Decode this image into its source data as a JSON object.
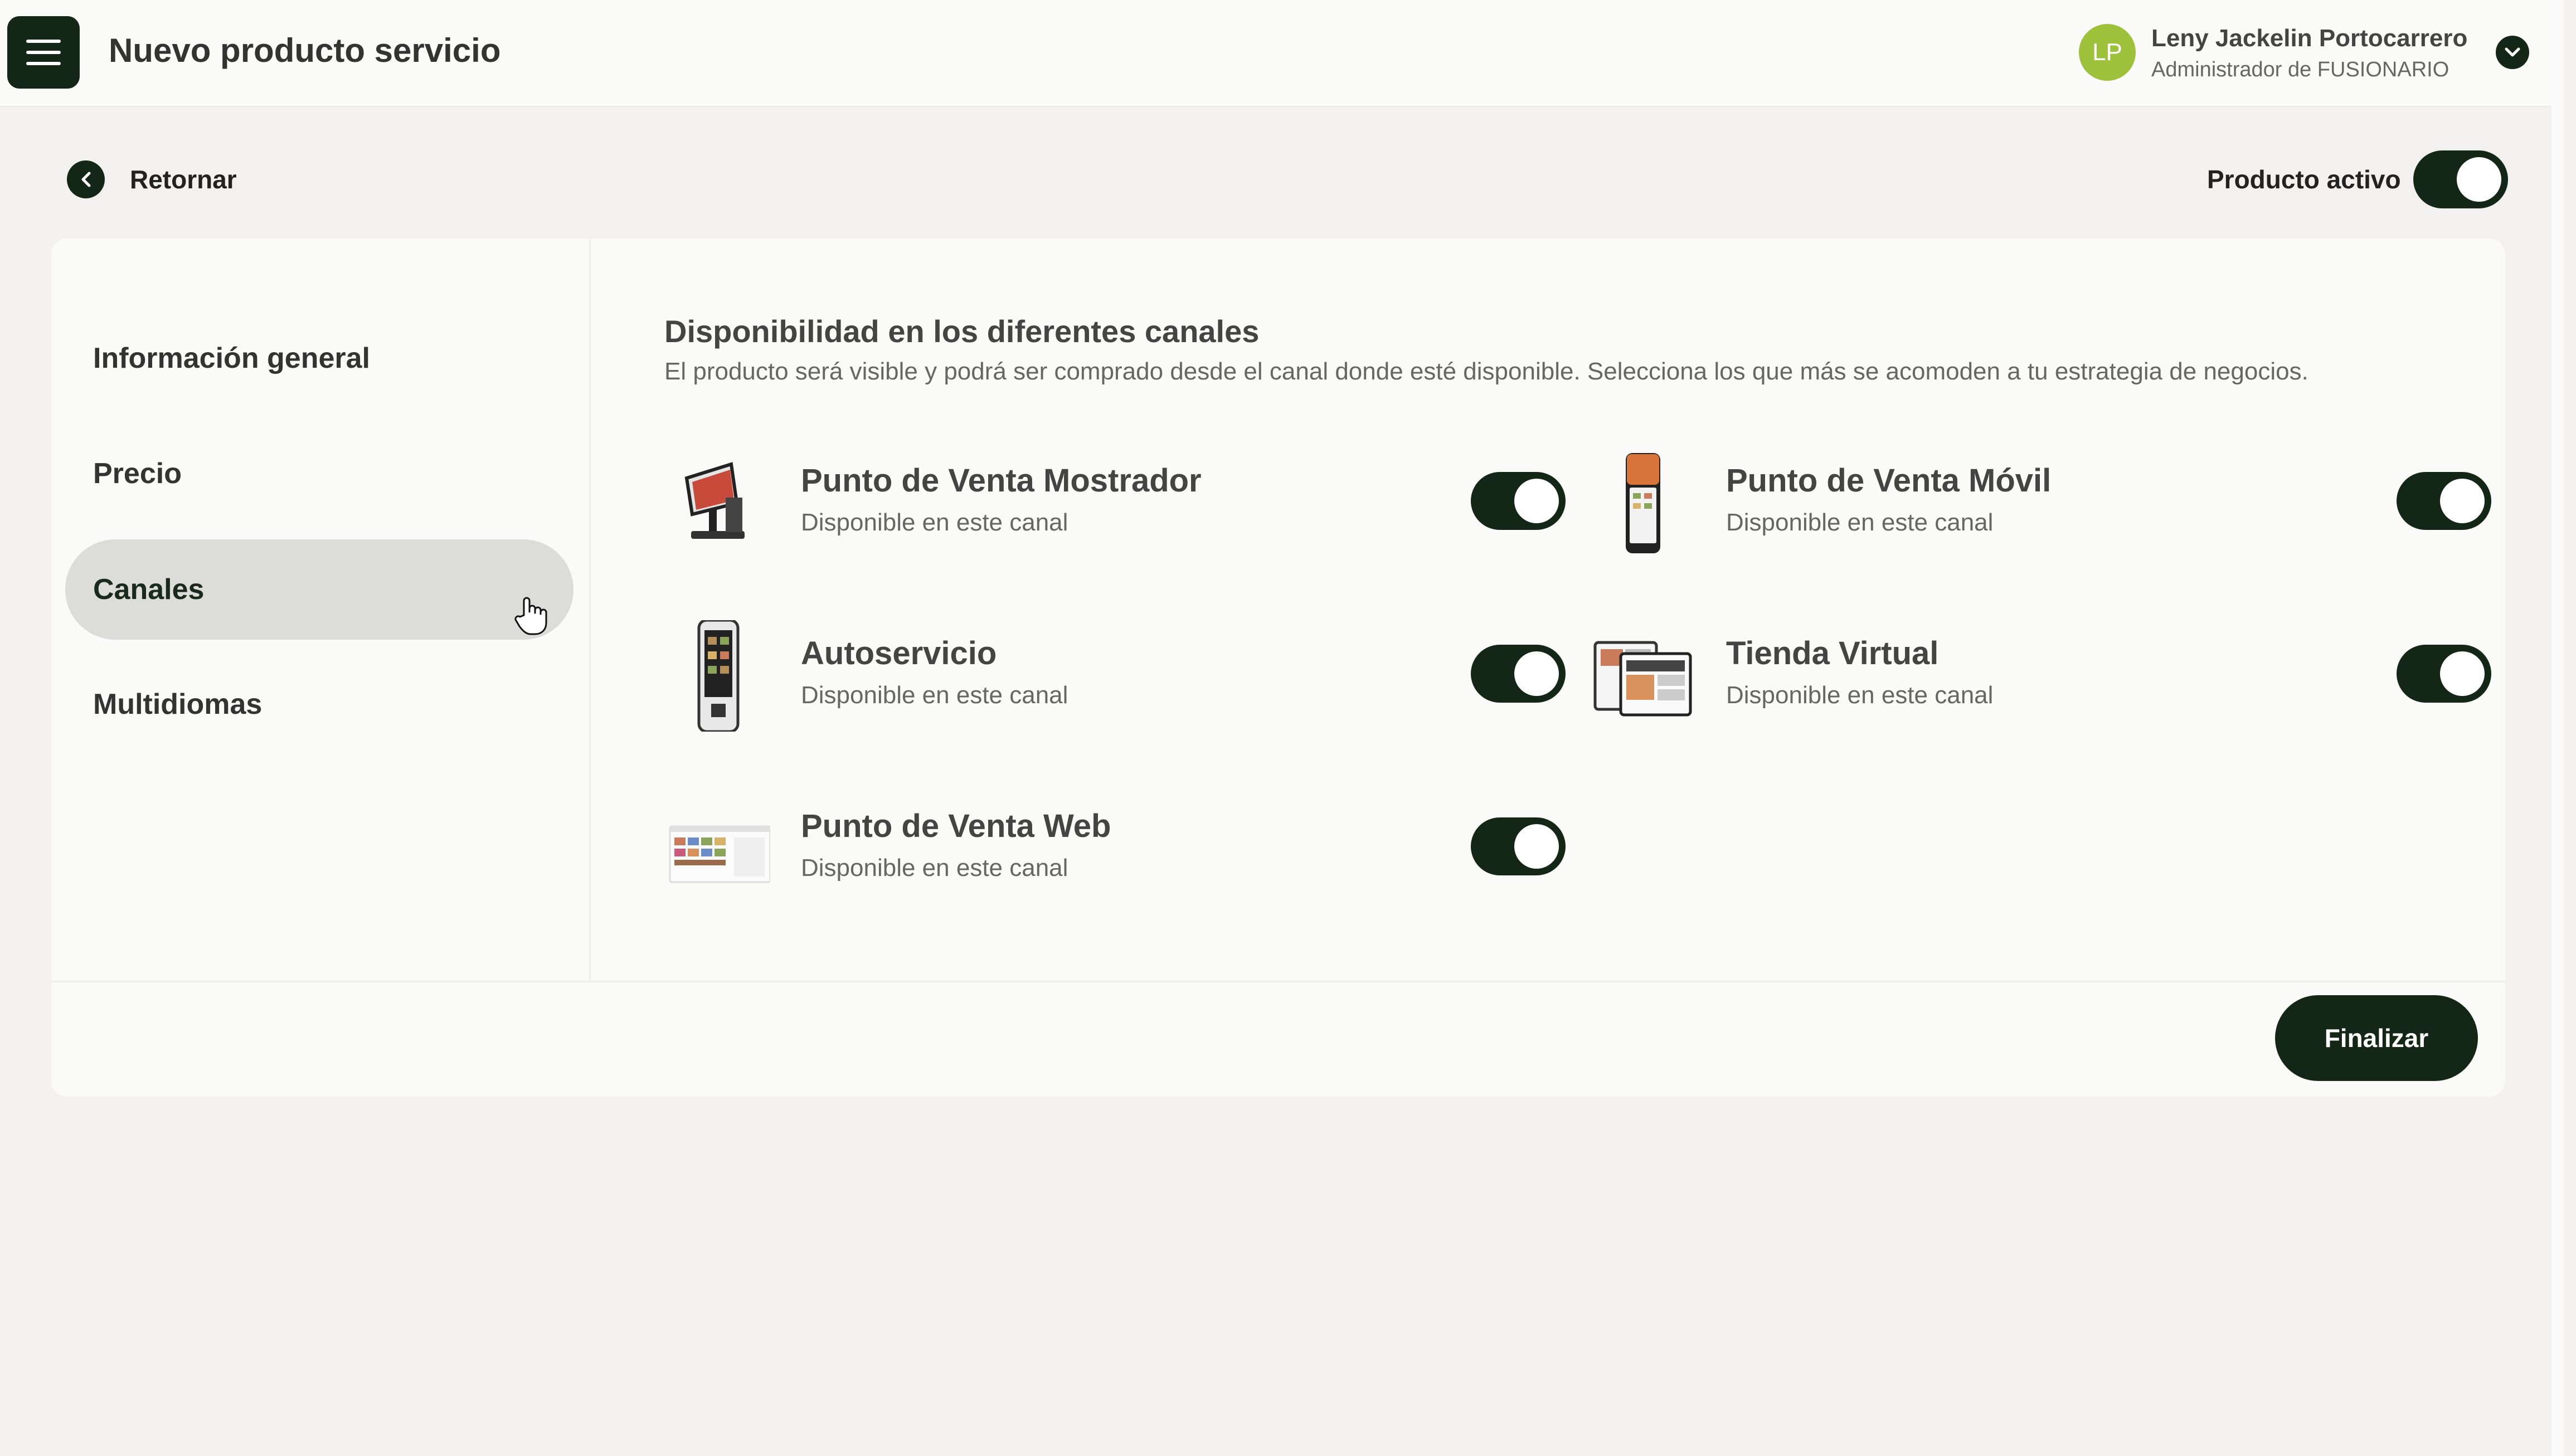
{
  "header": {
    "title": "Nuevo producto servicio",
    "menu_icon": "hamburger-menu-icon",
    "user": {
      "initials": "LP",
      "name": "Leny Jackelin Portocarrero",
      "role": "Administrador de FUSIONARIO",
      "avatar_color": "#9dc13b"
    }
  },
  "back": {
    "label": "Retornar",
    "icon": "chevron-left-icon"
  },
  "product_active": {
    "label": "Producto activo",
    "on": true
  },
  "sidebar": {
    "items": [
      {
        "label": "Información general",
        "selected": false
      },
      {
        "label": "Precio",
        "selected": false
      },
      {
        "label": "Canales",
        "selected": true
      },
      {
        "label": "Multidiomas",
        "selected": false
      }
    ]
  },
  "main": {
    "title": "Disponibilidad en los diferentes canales",
    "description": "El producto será visible y podrá ser comprado desde el canal donde esté disponible. Selecciona los que más se acomoden a tu estrategia de negocios.",
    "channels": [
      {
        "name": "Punto de Venta Mostrador",
        "status": "Disponible en este canal",
        "enabled": true,
        "icon": "pos-terminal-icon"
      },
      {
        "name": "Punto de Venta Móvil",
        "status": "Disponible en este canal",
        "enabled": true,
        "icon": "mobile-pos-icon"
      },
      {
        "name": "Autoservicio",
        "status": "Disponible en este canal",
        "enabled": true,
        "icon": "kiosk-icon"
      },
      {
        "name": "Tienda Virtual",
        "status": "Disponible en este canal",
        "enabled": true,
        "icon": "online-store-icon"
      },
      {
        "name": "Punto de Venta Web",
        "status": "Disponible en este canal",
        "enabled": true,
        "icon": "web-pos-icon"
      }
    ]
  },
  "footer": {
    "finish_label": "Finalizar"
  },
  "colors": {
    "primary": "#142615",
    "background": "#f2f1ef",
    "card": "#fafaf8",
    "selected_nav": "#dcdcd8"
  }
}
